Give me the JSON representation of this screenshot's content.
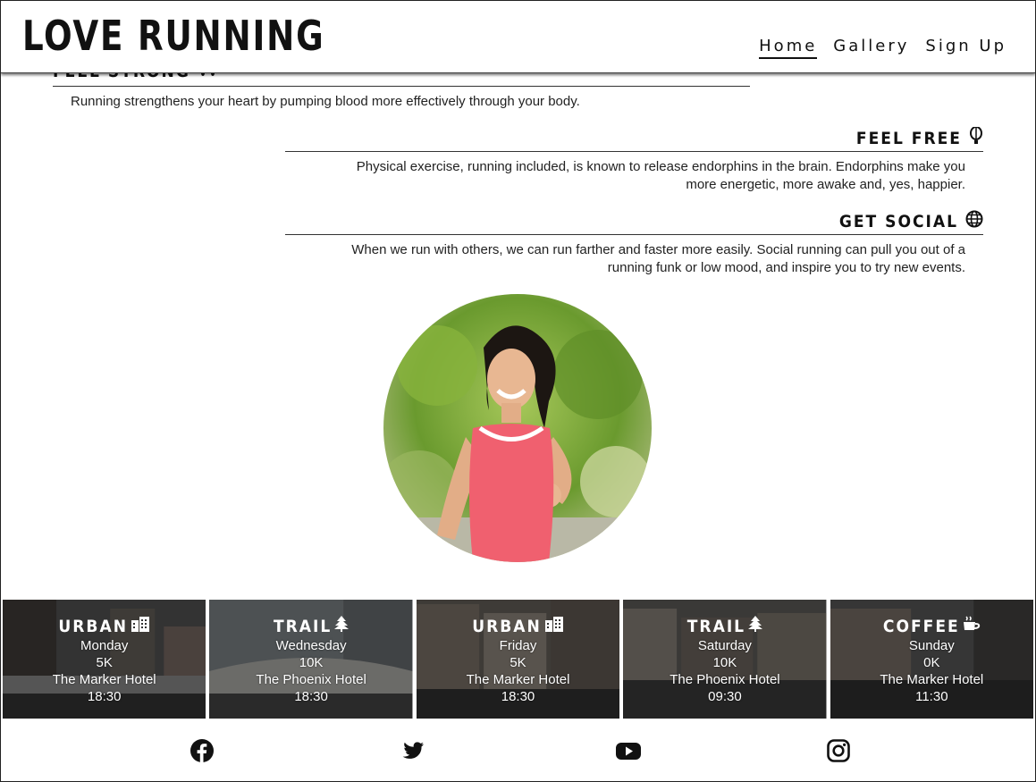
{
  "site": {
    "logo": "LOVE RUNNING"
  },
  "nav": [
    {
      "label": "Home",
      "active": true
    },
    {
      "label": "Gallery",
      "active": false
    },
    {
      "label": "Sign Up",
      "active": false
    }
  ],
  "sections": {
    "strong": {
      "title": "FEEL STRONG",
      "text": "Running strengthens your heart by pumping blood more effectively through your body."
    },
    "free": {
      "title": "FEEL FREE",
      "text_line1": "Physical exercise, running included, is known to release endorphins in the brain. Endorphins make you",
      "text_line2": "more energetic, more awake and, yes, happier."
    },
    "social": {
      "title": "GET SOCIAL",
      "text_line1": "When we run with others, we can run farther and faster more easily. Social running can pull you out of a",
      "text_line2": "running funk or low mood, and inspire you to try new events."
    }
  },
  "events": [
    {
      "type": "URBAN",
      "icon": "city-icon",
      "day": "Monday",
      "distance": "5K",
      "venue": "The Marker Hotel",
      "time": "18:30"
    },
    {
      "type": "TRAIL",
      "icon": "tree-icon",
      "day": "Wednesday",
      "distance": "10K",
      "venue": "The Phoenix Hotel",
      "time": "18:30"
    },
    {
      "type": "URBAN",
      "icon": "city-icon",
      "day": "Friday",
      "distance": "5K",
      "venue": "The Marker Hotel",
      "time": "18:30"
    },
    {
      "type": "TRAIL",
      "icon": "tree-icon",
      "day": "Saturday",
      "distance": "10K",
      "venue": "The Phoenix Hotel",
      "time": "09:30"
    },
    {
      "type": "COFFEE",
      "icon": "coffee-icon",
      "day": "Sunday",
      "distance": "0K",
      "venue": "The Marker Hotel",
      "time": "11:30"
    }
  ],
  "footer": {
    "social": [
      "facebook-icon",
      "twitter-icon",
      "youtube-icon",
      "instagram-icon"
    ]
  },
  "colors": {
    "text": "#111111",
    "overlay": "#000000",
    "white": "#ffffff"
  }
}
